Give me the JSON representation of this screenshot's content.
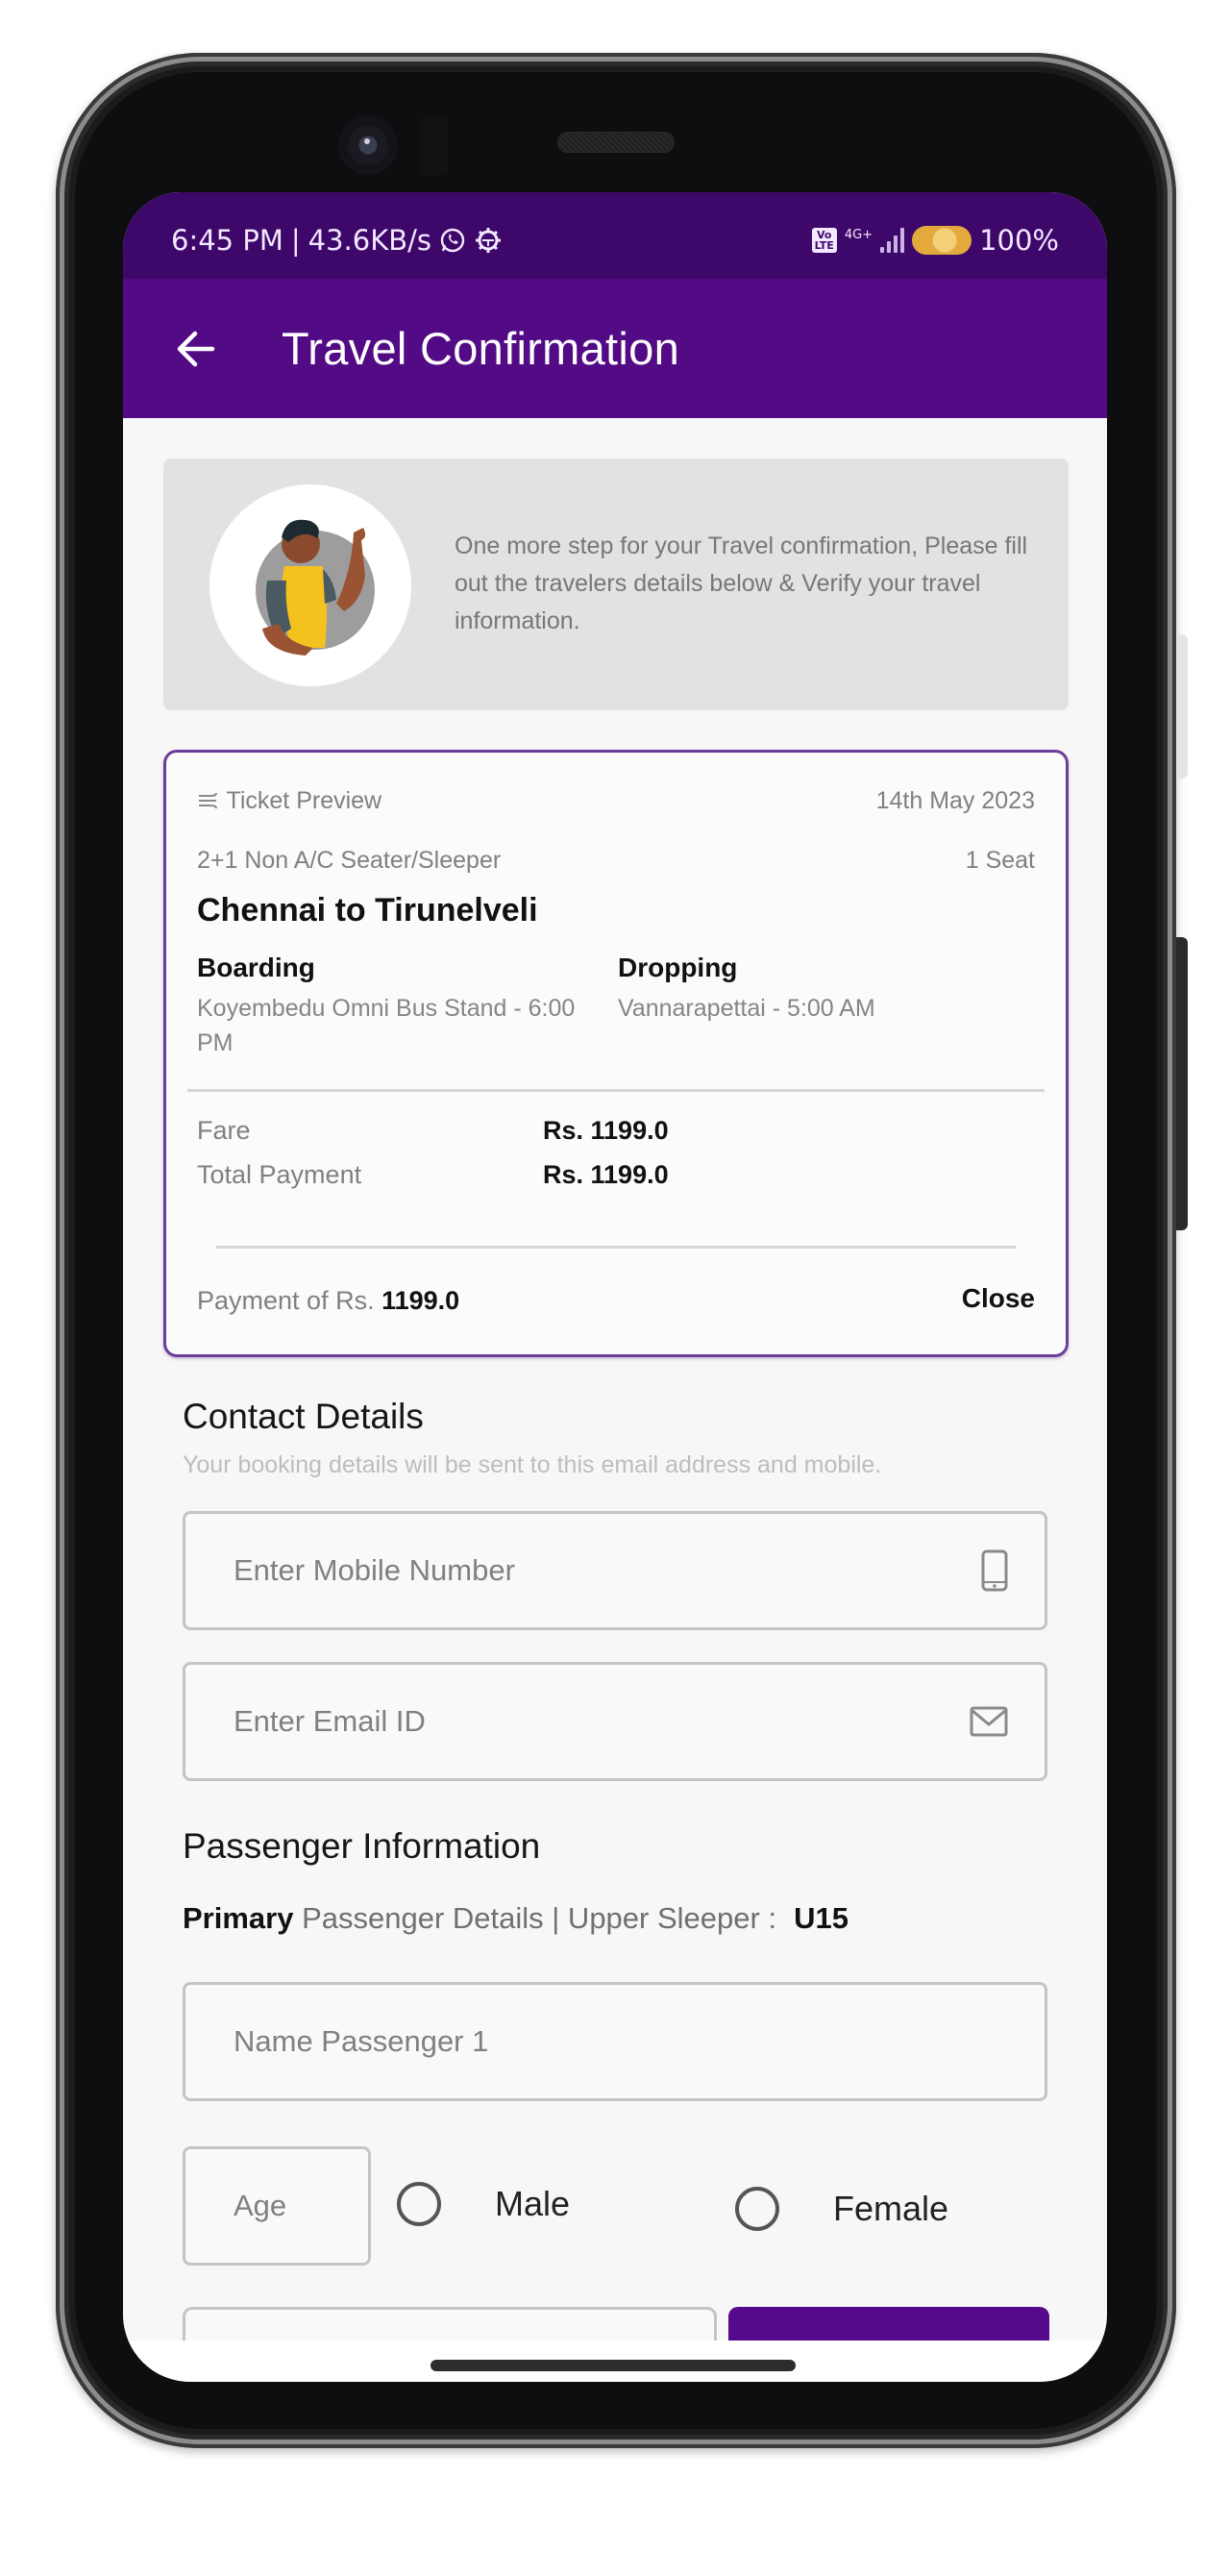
{
  "status_bar": {
    "time": "6:45 PM",
    "separator": "|",
    "network_speed": "43.6KB/s",
    "icons_left": [
      "whatsapp-icon",
      "settings-gear-icon"
    ],
    "volte_label": "Vo\nLTE",
    "network_type": "4G+",
    "battery_percent": "100%"
  },
  "app_bar": {
    "back_icon": "arrow-left-icon",
    "title": "Travel Confirmation"
  },
  "banner": {
    "illustration": "waving-person-illustration",
    "message": "One more step for your Travel confirmation, Please fill out the travelers details below & Verify your travel information."
  },
  "ticket": {
    "header_icon": "ticket-preview-icon",
    "header_label": "Ticket Preview",
    "date": "14th May 2023",
    "bus_type": "2+1 Non A/C Seater/Sleeper",
    "seats": "1 Seat",
    "route": "Chennai to Tirunelveli",
    "boarding": {
      "title": "Boarding",
      "value": "Koyembedu Omni Bus Stand - 6:00 PM"
    },
    "dropping": {
      "title": "Dropping",
      "value": "Vannarapettai - 5:00 AM"
    },
    "fare_rows": [
      {
        "label": "Fare",
        "value": "Rs. 1199.0"
      },
      {
        "label": "Total Payment",
        "value": "Rs. 1199.0"
      }
    ],
    "payment_prefix": "Payment of Rs. ",
    "payment_amount": "1199.0",
    "close_label": "Close"
  },
  "contact": {
    "title": "Contact Details",
    "subtitle": "Your booking details will be sent to this email address and mobile.",
    "mobile": {
      "placeholder": "Enter Mobile Number",
      "value": "",
      "icon": "mobile-phone-icon"
    },
    "email": {
      "placeholder": "Enter Email ID",
      "value": "",
      "icon": "envelope-icon"
    }
  },
  "passenger": {
    "title": "Passenger Information",
    "primary_label": "Primary",
    "details_label": " Passenger Details | Upper Sleeper :",
    "seat_number": "U15",
    "name": {
      "placeholder": "Name Passenger 1",
      "value": ""
    },
    "age": {
      "placeholder": "Age",
      "value": ""
    },
    "gender_options": [
      {
        "label": "Male",
        "selected": false
      },
      {
        "label": "Female",
        "selected": false
      }
    ]
  },
  "colors": {
    "status_bar": "#3e086a",
    "app_bar": "#520a85",
    "accent": "#540a8a",
    "card_border": "#6b3e9a",
    "banner_bg": "#e2e2e2",
    "page_bg": "#f7f7f7"
  }
}
